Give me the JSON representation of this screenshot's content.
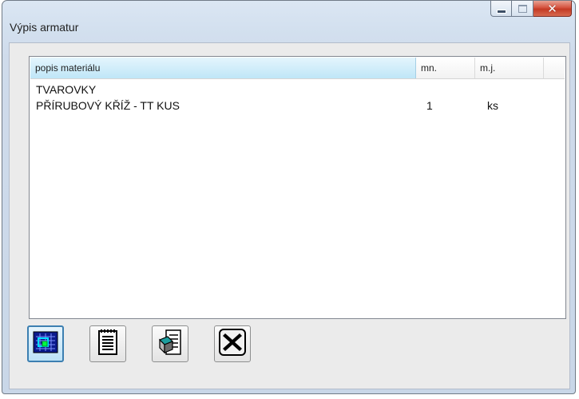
{
  "window": {
    "title": "Výpis armatur",
    "controls": {
      "minimize": "minimize-icon",
      "maximize": "maximize-icon",
      "close": "close-icon"
    }
  },
  "table": {
    "columns": [
      "popis materiálu",
      "mn.",
      "m.j."
    ],
    "rows": [
      {
        "popis": "TVAROVKY",
        "mn": "",
        "mj": ""
      },
      {
        "popis": "PŘÍRUBOVÝ KŘÍŽ - TT KUS",
        "mn": "1",
        "mj": "ks"
      }
    ]
  },
  "toolbar": [
    {
      "icon": "cad-drawing-icon",
      "state": "active"
    },
    {
      "icon": "notepad-icon"
    },
    {
      "icon": "export-document-icon"
    },
    {
      "icon": "close-x-icon"
    }
  ],
  "colors": {
    "header_selected": "#bfe6f7",
    "close_button": "#c43a24",
    "active_button_border": "#3c7fb1"
  }
}
